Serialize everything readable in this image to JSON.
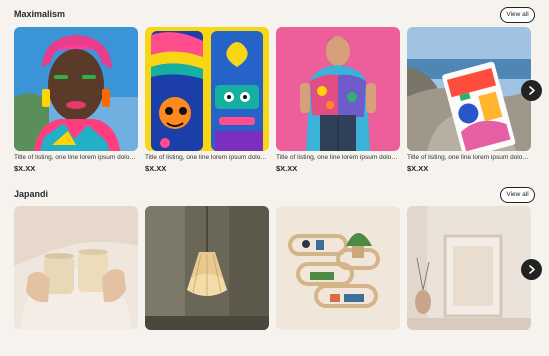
{
  "sections": [
    {
      "title": "Maximalism",
      "view_all": "View all",
      "items": [
        {
          "title": "Title of listing, one line lorem ipsum dolor sit amet",
          "price": "$X.XX"
        },
        {
          "title": "Title of listing, one line lorem ipsum dolor sit amet",
          "price": "$X.XX"
        },
        {
          "title": "Title of listing, one line lorem ipsum dolor sit amet",
          "price": "$X.XX"
        },
        {
          "title": "Title of listing, one line lorem ipsum dolor sit amet",
          "price": "$X.XX"
        }
      ]
    },
    {
      "title": "Japandi",
      "view_all": "View all",
      "items": [
        {},
        {},
        {},
        {}
      ]
    }
  ],
  "icons": {
    "next": "chevron-right-icon"
  },
  "colors": {
    "background": "#f6f3ef",
    "button_dark": "#222222"
  }
}
